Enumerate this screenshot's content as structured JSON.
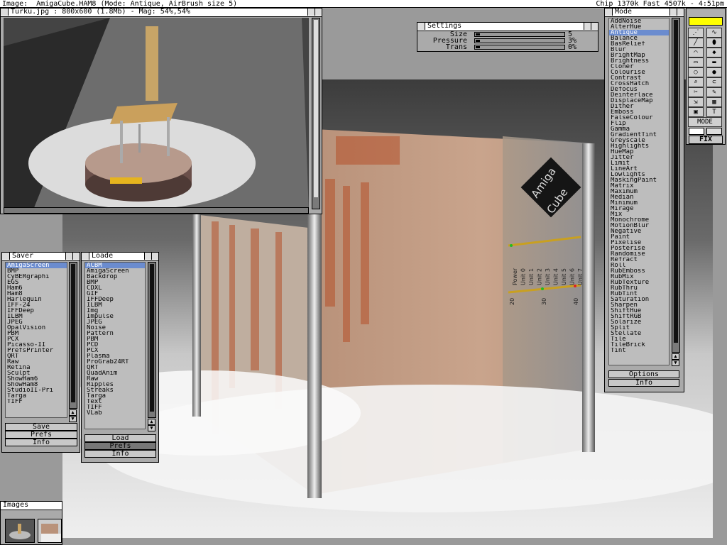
{
  "screen": {
    "title": "Image: _AmigaCube.HAM8 (Mode: Antique, AirBrush size 5)",
    "status": "Chip  1370k  Fast  4507k - 4:51pm"
  },
  "preview": {
    "title": "Turku.jpg : 800x600 (1.8Mb) - Mag: 54%,54%"
  },
  "cube": {
    "brand_line1": "Amiga",
    "brand_line2": "Cube",
    "leds": [
      "Power",
      "Unit 0",
      "Unit 1",
      "Unit 2",
      "Unit 3",
      "Unit 4",
      "Unit 5",
      "Unit 6",
      "Unit 7"
    ],
    "scale": [
      "20",
      "30",
      "40"
    ]
  },
  "settings": {
    "title": "Settings",
    "rows": [
      {
        "label": "Size",
        "value": "5"
      },
      {
        "label": "Pressure",
        "value": "3%"
      },
      {
        "label": "Trans",
        "value": "0%"
      }
    ]
  },
  "mode": {
    "title": "Mode",
    "selected": "Antique",
    "items": [
      "AddNoise",
      "AlterHue",
      "Antique",
      "Balance",
      "BasRelief",
      "Blur",
      "BrightMap",
      "Brightness",
      "Cloner",
      "Colourise",
      "Contrast",
      "CrossHatch",
      "Defocus",
      "Deinterlace",
      "DisplaceMap",
      "Dither",
      "Emboss",
      "FalseColour",
      "Flip",
      "Gamma",
      "GradientTint",
      "Greyscale",
      "Highlights",
      "HueMap",
      "Jitter",
      "Limit",
      "LineArt",
      "Lowlights",
      "MaskingPaint",
      "Matrix",
      "Maximum",
      "Median",
      "Minimum",
      "Mirage",
      "Mix",
      "Monochrome",
      "MotionBlur",
      "Negative",
      "Paint",
      "Pixelise",
      "Posterise",
      "Randomise",
      "Refract",
      "Roll",
      "RubEmboss",
      "RubMix",
      "RubTexture",
      "RubThru",
      "RubTint",
      "Saturation",
      "Sharpen",
      "ShiftHue",
      "ShiftRGB",
      "Solarize",
      "Split",
      "Stellate",
      "Tile",
      "TileBrick",
      "Tint"
    ],
    "options_label": "Options",
    "info_label": "Info"
  },
  "saver": {
    "title": "Saver",
    "selected": "AmigaScreen",
    "items": [
      "AmigaScreen",
      "BMP",
      "CyBERgraphi",
      "EGS",
      "Ham6",
      "Ham8",
      "Harlequin",
      "IFF-24",
      "IFFDeep",
      "ILBM",
      "JPEG",
      "OpalVision",
      "PBM",
      "PCX",
      "Picasso-II",
      "PrefsPrinter",
      "QRT",
      "Raw",
      "Retina",
      "Sculpt",
      "ShowHam6",
      "ShowHam8",
      "StudioII-Pri",
      "Targa",
      "TIFF"
    ],
    "save_label": "Save",
    "prefs_label": "Prefs",
    "info_label": "Info"
  },
  "loader": {
    "title": "Loade",
    "selected": "ACBM",
    "items": [
      "ACBM",
      "AmigaScreen",
      "Backdrop",
      "BMP",
      "CDXL",
      "GIF",
      "IFFDeep",
      "ILBM",
      "Img",
      "Impulse",
      "JPEG",
      "Noise",
      "Pattern",
      "PBM",
      "PCD",
      "PCX",
      "Plasma",
      "ProGrab24RT",
      "QRT",
      "QuadAnim",
      "Raw",
      "Ripples",
      "Streaks",
      "Targa",
      "Text",
      "TIFF",
      "VLab"
    ],
    "load_label": "Load",
    "prefs_label": "Prefs",
    "info_label": "Info"
  },
  "images": {
    "title": "Images"
  },
  "toolbox": {
    "mode_label": "MODE",
    "fix_label": "FIX",
    "colors": {
      "foreground": "#ffff00",
      "background": "#ffffff"
    },
    "tools": [
      "dotted-line-icon",
      "curve-icon",
      "line-icon",
      "ellipse-brush-icon",
      "arc-icon",
      "fill-icon",
      "rectangle-icon",
      "filled-rectangle-icon",
      "oval-icon",
      "filled-oval-icon",
      "magnify-icon",
      "lasso-icon",
      "scissors-icon",
      "pencil-icon",
      "brush-icon",
      "grid-icon",
      "stamp-icon",
      "text-icon",
      "spray-icon",
      "eraser-icon"
    ]
  }
}
